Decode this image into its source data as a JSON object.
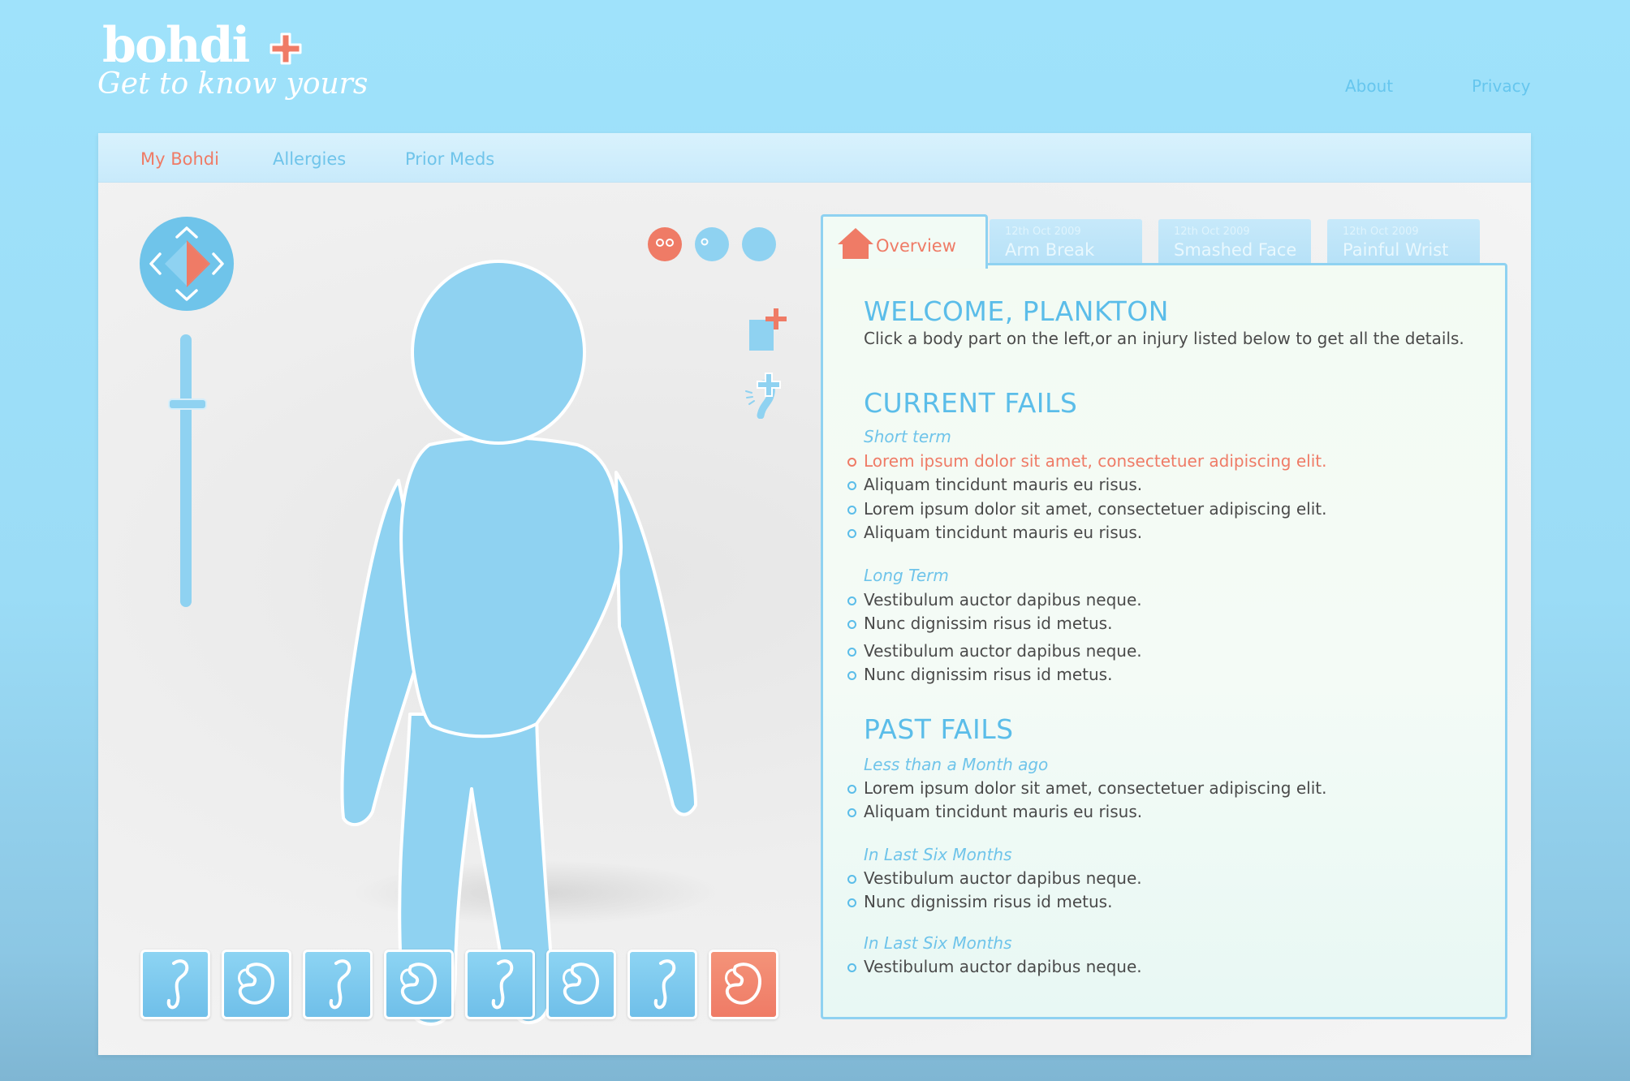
{
  "brand": {
    "name": "bohdi",
    "tagline": "Get to know yours",
    "accent_color": "#ef7b66",
    "primary_color": "#8fd2f1"
  },
  "top_nav": {
    "about": "About",
    "privacy": "Privacy"
  },
  "main_tabs": [
    {
      "label": "My Bohdi",
      "active": true
    },
    {
      "label": "Allergies",
      "active": false
    },
    {
      "label": "Prior Meds",
      "active": false
    }
  ],
  "left_tools": {
    "nav_control_icon": "direction-pad-icon",
    "zoom_slider_level": 0.75,
    "view_buttons": [
      "front-face-icon",
      "side-face-icon",
      "back-head-icon"
    ],
    "action_icons": [
      "add-record-icon",
      "add-injury-icon"
    ]
  },
  "bottom_thumbnails": [
    {
      "icon": "femur-bone-icon",
      "active": false
    },
    {
      "icon": "kidney-icon",
      "active": false
    },
    {
      "icon": "femur-bone-icon",
      "active": false
    },
    {
      "icon": "kidney-icon",
      "active": false
    },
    {
      "icon": "femur-bone-icon",
      "active": false
    },
    {
      "icon": "kidney-icon",
      "active": false
    },
    {
      "icon": "femur-bone-icon",
      "active": false
    },
    {
      "icon": "kidney-icon",
      "active": true
    }
  ],
  "detail_tabs": {
    "overview": {
      "label": "Overview",
      "icon": "home-icon"
    },
    "injuries": [
      {
        "date": "12th Oct 2009",
        "title": "Arm Break"
      },
      {
        "date": "12th Oct 2009",
        "title": "Smashed Face"
      },
      {
        "date": "12th Oct 2009",
        "title": "Painful Wrist"
      }
    ]
  },
  "overview": {
    "welcome_title": "WELCOME, PLANKTON",
    "intro": "Click a body part on the left,or an injury listed below to get all the details.",
    "current": {
      "title": "CURRENT FAILS",
      "short_term_label": "Short term",
      "short_term": [
        "Lorem ipsum dolor sit amet, consectetuer adipiscing elit.",
        "Aliquam tincidunt mauris eu risus.",
        "Lorem ipsum dolor sit amet, consectetuer adipiscing elit.",
        "Aliquam tincidunt mauris eu risus."
      ],
      "long_term_label": "Long Term",
      "long_term": [
        "Vestibulum auctor dapibus neque.",
        "Nunc dignissim risus id metus.",
        "Vestibulum auctor dapibus neque.",
        "Nunc dignissim risus id metus."
      ]
    },
    "past": {
      "title": "PAST FAILS",
      "month_label": "Less than a Month ago",
      "month": [
        "Lorem ipsum dolor sit amet, consectetuer adipiscing elit.",
        "Aliquam tincidunt mauris eu risus."
      ],
      "six_months_label": "In Last Six Months",
      "six_months": [
        "Vestibulum auctor dapibus neque.",
        "Nunc dignissim risus id metus."
      ],
      "six_months_2_label": "In Last Six Months",
      "six_months_2": [
        "Vestibulum auctor dapibus neque."
      ]
    }
  }
}
